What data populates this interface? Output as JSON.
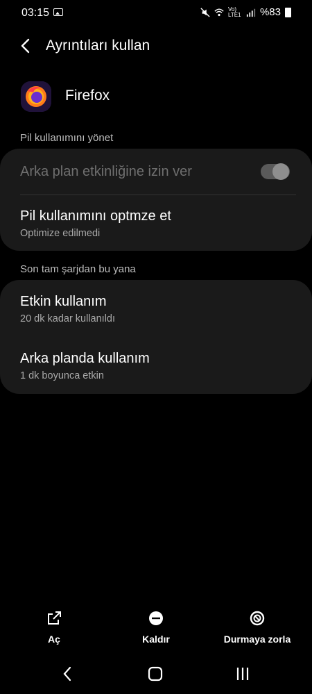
{
  "status_bar": {
    "time": "03:15",
    "battery": "%83",
    "network": "Vo) LTE1"
  },
  "header": {
    "title": "Ayrıntıları kullan"
  },
  "app": {
    "name": "Firefox"
  },
  "section_manage": {
    "label": "Pil kullanımını yönet"
  },
  "card_manage": {
    "background_activity": {
      "label": "Arka plan etkinliğine izin ver",
      "enabled": true,
      "disabled_state": true
    },
    "optimize": {
      "title": "Pil kullanımını optmze et",
      "subtitle": "Optimize edilmedi"
    }
  },
  "section_since_charge": {
    "label": "Son tam şarjdan bu yana"
  },
  "card_usage": {
    "active": {
      "title": "Etkin kullanım",
      "subtitle": "20 dk kadar kullanıldı"
    },
    "background": {
      "title": "Arka planda kullanım",
      "subtitle": "1 dk boyunca etkin"
    }
  },
  "actions": {
    "open": "Aç",
    "uninstall": "Kaldır",
    "force_stop": "Durmaya zorla"
  },
  "icons": {
    "back": "chevron-left-icon",
    "open": "open-external-icon",
    "uninstall": "minus-circle-icon",
    "force_stop": "stop-circle-icon"
  },
  "colors": {
    "background": "#000000",
    "card": "#1a1a1a",
    "secondary_text": "#a9a9a9"
  }
}
